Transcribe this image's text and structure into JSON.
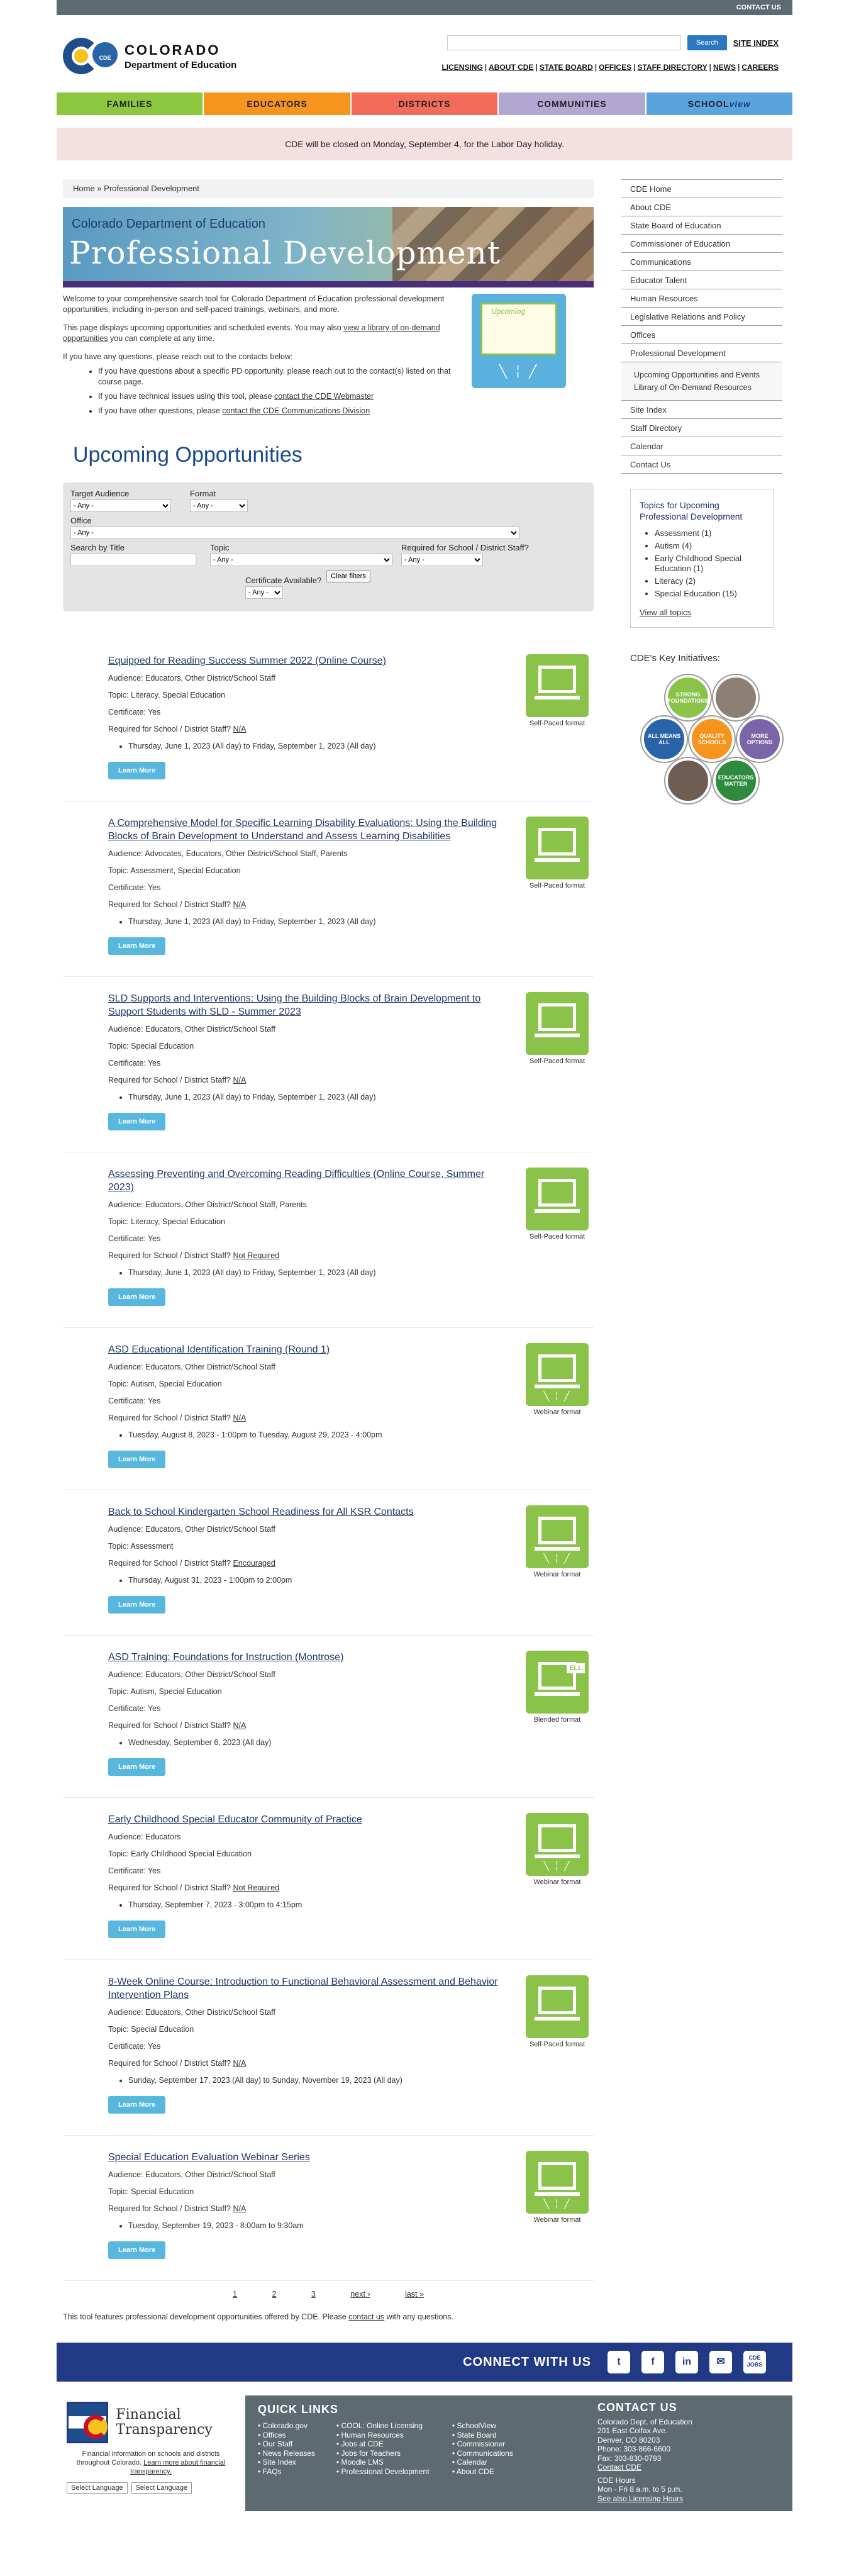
{
  "topbar": {
    "contact": "CONTACT US"
  },
  "header": {
    "logo_line1": "COLORADO",
    "logo_line2": "Department of Education",
    "logo_badge": "CDE",
    "search_placeholder": "",
    "search_button": "Search",
    "site_index": "SITE INDEX",
    "util_links": [
      "LICENSING",
      "ABOUT CDE",
      "STATE BOARD",
      "OFFICES",
      "STAFF DIRECTORY",
      "NEWS",
      "CAREERS"
    ]
  },
  "nav": {
    "families": "FAMILIES",
    "educators": "EDUCATORS",
    "districts": "DISTRICTS",
    "communities": "COMMUNITIES",
    "schoolview_a": "SCHOOL",
    "schoolview_b": "view"
  },
  "alert": "CDE will be closed on Monday, September 4, for the Labor Day holiday.",
  "breadcrumb": {
    "home": "Home",
    "sep": " » ",
    "current": "Professional Development"
  },
  "banner": {
    "sub": "Colorado Department of Education",
    "title": "Professional Development"
  },
  "intro": {
    "p1": "Welcome to your comprehensive search tool for Colorado Department of Education professional development opportunities, including in-person and self-paced trainings, webinars, and more.",
    "p2a": "This page displays upcoming opportunities and scheduled events. You may also ",
    "p2link": "view a library of on-demand opportunities",
    "p2b": " you can complete at any time.",
    "p3": "If you have any questions, please reach out to the contacts below:",
    "b1": "If you have questions about a specific PD opportunity, please reach out to the contact(s) listed on that course page.",
    "b2a": "If you have technical issues using this tool, please ",
    "b2link": "contact the CDE Webmaster",
    "b3a": "If you have other questions, please ",
    "b3link": "contact the CDE Communications Division",
    "cal_title": "Upcoming"
  },
  "heading": "Upcoming Opportunities",
  "filters": {
    "target_label": "Target Audience",
    "target_val": "- Any -",
    "format_label": "Format",
    "format_val": "- Any -",
    "office_label": "Office",
    "office_val": "- Any -",
    "search_label": "Search by Title",
    "topic_label": "Topic",
    "topic_val": "- Any -",
    "required_label": "Required for School / District Staff?",
    "required_val": "- Any -",
    "cert_label": "Certificate Available?",
    "cert_val": "- Any -",
    "clear": "Clear filters"
  },
  "events": [
    {
      "title": "Equipped for Reading Success Summer 2022 (Online Course)",
      "audience": "Audience: Educators, Other District/School Staff",
      "topic": "Topic: Literacy, Special Education",
      "cert": "Certificate: Yes",
      "req_label": "Required for School / District Staff? ",
      "req": "N/A",
      "date": "Thursday, June 1, 2023 (All day) to Friday, September 1, 2023 (All day)",
      "fmt": "Self-Paced format"
    },
    {
      "title": "A Comprehensive Model for Specific Learning Disability Evaluations: Using the Building Blocks of Brain Development to Understand and Assess Learning Disabilities",
      "audience": "Audience: Advocates, Educators, Other District/School Staff, Parents",
      "topic": "Topic: Assessment, Special Education",
      "cert": "Certificate: Yes",
      "req_label": "Required for School / District Staff? ",
      "req": "N/A",
      "date": "Thursday, June 1, 2023 (All day) to Friday, September 1, 2023 (All day)",
      "fmt": "Self-Paced format"
    },
    {
      "title": "SLD Supports and Interventions: Using the Building Blocks of Brain Development to Support Students with SLD - Summer 2023",
      "audience": "Audience: Educators, Other District/School Staff",
      "topic": "Topic: Special Education",
      "cert": "Certificate: Yes",
      "req_label": "Required for School / District Staff? ",
      "req": "N/A",
      "date": "Thursday, June 1, 2023 (All day) to Friday, September 1, 2023 (All day)",
      "fmt": "Self-Paced format"
    },
    {
      "title": "Assessing Preventing and Overcoming Reading Difficulties (Online Course, Summer 2023)",
      "audience": "Audience: Educators, Other District/School Staff, Parents",
      "topic": "Topic: Literacy, Special Education",
      "cert": "Certificate: Yes",
      "req_label": "Required for School / District Staff? ",
      "req": "Not Required",
      "date": "Thursday, June 1, 2023 (All day) to Friday, September 1, 2023 (All day)",
      "fmt": "Self-Paced format"
    },
    {
      "title": "ASD Educational Identification Training (Round 1)",
      "audience": "Audience: Educators, Other District/School Staff",
      "topic": "Topic: Autism, Special Education",
      "cert": "Certificate: Yes",
      "req_label": "Required for School / District Staff? ",
      "req": "N/A",
      "date": "Tuesday, August 8, 2023 - 1:00pm to Tuesday, August 29, 2023 - 4:00pm",
      "fmt": "Webinar format"
    },
    {
      "title": "Back to School Kindergarten School Readiness for All KSR Contacts",
      "audience": "Audience: Educators, Other District/School Staff",
      "topic": "Topic: Assessment",
      "cert": "",
      "req_label": "Required for School / District Staff? ",
      "req": "Encouraged",
      "date": "Thursday, August 31, 2023 - 1:00pm to 2:00pm",
      "fmt": "Webinar format"
    },
    {
      "title": "ASD Training: Foundations for Instruction (Montrose)",
      "audience": "Audience: Educators, Other District/School Staff",
      "topic": "Topic: Autism, Special Education",
      "cert": "Certificate: Yes",
      "req_label": "Required for School / District Staff? ",
      "req": "N/A",
      "date": "Wednesday, September 6, 2023 (All day)",
      "fmt": "Blended format"
    },
    {
      "title": "Early Childhood Special Educator Community of Practice",
      "audience": "Audience: Educators",
      "topic": "Topic: Early Childhood Special Education",
      "cert": "Certificate: Yes",
      "req_label": "Required for School / District Staff? ",
      "req": "Not Required",
      "date": "Thursday, September 7, 2023 - 3:00pm to 4:15pm",
      "fmt": "Webinar format"
    },
    {
      "title": "8-Week Online Course: Introduction to Functional Behavioral Assessment and Behavior Intervention Plans",
      "audience": "Audience: Educators, Other District/School Staff",
      "topic": "Topic: Special Education",
      "cert": "Certificate: Yes",
      "req_label": "Required for School / District Staff? ",
      "req": "N/A",
      "date": "Sunday, September 17, 2023 (All day) to Sunday, November 19, 2023 (All day)",
      "fmt": "Self-Paced format"
    },
    {
      "title": "Special Education Evaluation Webinar Series",
      "audience": "Audience: Educators, Other District/School Staff",
      "topic": "Topic: Special Education",
      "cert": "",
      "req_label": "Required for School / District Staff? ",
      "req": "N/A",
      "date": "Tuesday, September 19, 2023 - 8:00am to 9:30am",
      "fmt": "Webinar format"
    }
  ],
  "learn_more": "Learn More",
  "pager": {
    "p1": "1",
    "p2": "2",
    "p3": "3",
    "next": "next ›",
    "last": "last »"
  },
  "disclaimer_a": "This tool features professional development opportunities offered by CDE. Please ",
  "disclaimer_link": "contact us",
  "disclaimer_b": " with any questions.",
  "sidenav": {
    "items_top": [
      "CDE Home",
      "About CDE",
      "State Board of Education",
      "Commissioner of Education",
      "Communications",
      "Educator Talent",
      "Human Resources",
      "Legislative Relations and Policy",
      "Offices",
      "Professional Development"
    ],
    "sub": [
      "Upcoming Opportunities and Events",
      "Library of On-Demand Resources"
    ],
    "items_bottom": [
      "Site Index",
      "Staff Directory",
      "Calendar",
      "Contact Us"
    ]
  },
  "topics": {
    "title": "Topics for Upcoming Professional Development",
    "items": [
      "Assessment (1)",
      "Autism (4)",
      "Early Childhood Special Education (1)",
      "Literacy (2)",
      "Special Education (15)"
    ],
    "view_all": "View all topics"
  },
  "initiatives": {
    "title": "CDE's Key Initiatives:",
    "items": [
      "STRONG FOUNDATIONS",
      "",
      "ALL MEANS ALL",
      "QUALITY SCHOOLS",
      "MORE OPTIONS",
      "",
      "EDUCATORS MATTER"
    ]
  },
  "connect": {
    "label": "CONNECT WITH US",
    "social": [
      "t",
      "f",
      "in",
      "✉",
      "CDE JOBS"
    ]
  },
  "footer": {
    "brand": "Financial Transparency",
    "desc_a": "Financial information on schools and districts throughout Colorado. ",
    "desc_link": "Learn more about financial transparency.",
    "lang1": "Select Language",
    "lang2": "Select Language",
    "quick_title": "QUICK LINKS",
    "col1": [
      "Colorado.gov",
      "Offices",
      "Our Staff",
      "News Releases",
      "Site Index",
      "FAQs"
    ],
    "col2": [
      "COOL: Online Licensing",
      "Human Resources",
      "Jobs at CDE",
      "Jobs for Teachers",
      "Moodle LMS",
      "Professional Development"
    ],
    "col3": [
      "SchoolView",
      "State Board",
      "Commissioner",
      "Communications",
      "Calendar",
      "About CDE"
    ],
    "contact_title": "CONTACT US",
    "contact": [
      "Colorado Dept. of Education",
      "201 East Colfax Ave.",
      "Denver, CO 80203",
      "Phone: 303-866-6600",
      "Fax: 303-830-0793"
    ],
    "contact_link": "Contact CDE",
    "hours_title": "CDE Hours",
    "hours": "Mon - Fri 8 a.m. to 5 p.m.",
    "hours_link": "See also Licensing Hours"
  }
}
